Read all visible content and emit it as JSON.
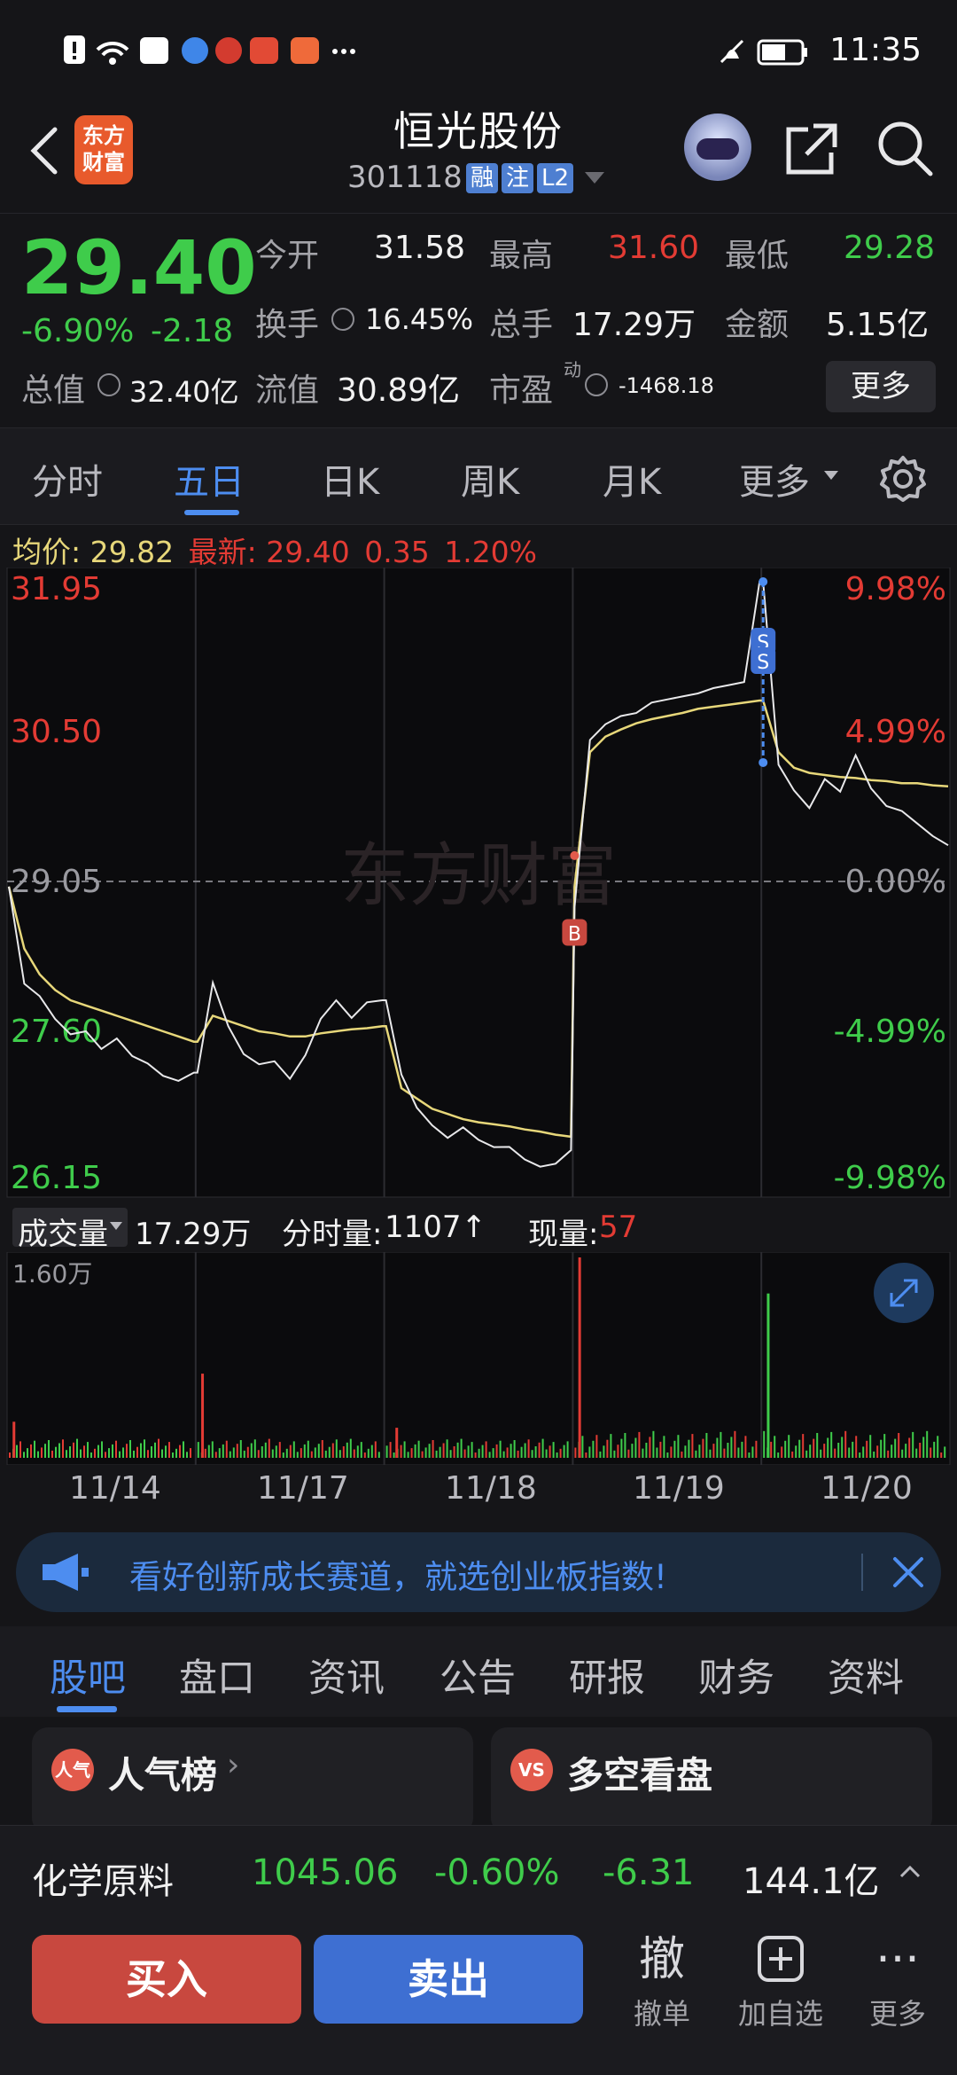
{
  "status_bar": {
    "time": "11:35"
  },
  "header": {
    "logo_text": "东方财富",
    "stock_name": "恒光股份",
    "stock_code": "301118",
    "tags": [
      "融",
      "注",
      "L2"
    ]
  },
  "quote": {
    "price": "29.40",
    "change_pct": "-6.90%",
    "change_abs": "-2.18",
    "fields": {
      "open_label": "今开",
      "open": "31.58",
      "high_label": "最高",
      "high": "31.60",
      "low_label": "最低",
      "low": "29.28",
      "turnover_label": "换手",
      "turnover": "16.45%",
      "volume_label": "总手",
      "volume": "17.29万",
      "amount_label": "金额",
      "amount": "5.15亿",
      "mktcap_label": "总值",
      "mktcap": "32.40亿",
      "float_label": "流值",
      "float": "30.89亿",
      "pe_label": "市盈",
      "pe_sup": "动",
      "pe": "-1468.18"
    },
    "more_label": "更多"
  },
  "tabs": [
    "分时",
    "五日",
    "日K",
    "周K",
    "月K",
    "更多"
  ],
  "legend": {
    "avg_label": "均价:",
    "avg": "29.82",
    "latest_label": "最新:",
    "latest": "29.40",
    "change": "0.35",
    "pct": "1.20%"
  },
  "chart_data": {
    "type": "line",
    "title": "",
    "y_left_ticks": [
      "31.95",
      "30.50",
      "29.05",
      "27.60",
      "26.15"
    ],
    "y_right_ticks": [
      "9.98%",
      "4.99%",
      "0.00%",
      "-4.99%",
      "-9.98%"
    ],
    "ylim": [
      26.15,
      31.95
    ],
    "x_categories": [
      "11/14",
      "11/17",
      "11/18",
      "11/19",
      "11/20"
    ],
    "watermark": "东方财富",
    "markers": [
      {
        "label": "B",
        "day": "11/18"
      },
      {
        "label": "S",
        "day": "11/19"
      },
      {
        "label": "S",
        "day": "11/19"
      }
    ],
    "price_series": [
      [
        29.0,
        28.05,
        27.95,
        27.75,
        27.55,
        27.6,
        27.45,
        27.5,
        27.35,
        27.3,
        27.2,
        27.1,
        27.2
      ],
      [
        27.2,
        28.05,
        27.65,
        27.4,
        27.25,
        27.3,
        27.15,
        27.4,
        27.7,
        27.9,
        27.75,
        27.85,
        27.9
      ],
      [
        27.9,
        27.15,
        26.85,
        26.7,
        26.6,
        26.65,
        26.55,
        26.5,
        26.45,
        26.35,
        26.3,
        26.35,
        26.45
      ],
      [
        28.8,
        30.45,
        30.55,
        30.65,
        30.7,
        30.75,
        30.8,
        30.85,
        30.9,
        30.9,
        30.95,
        31.0,
        31.95
      ],
      [
        31.95,
        30.2,
        29.9,
        29.75,
        30.05,
        29.95,
        30.25,
        29.95,
        29.8,
        29.7,
        29.6,
        29.5,
        29.4
      ]
    ],
    "avg_series": [
      [
        29.0,
        28.4,
        28.15,
        28.0,
        27.9,
        27.85,
        27.8,
        27.75,
        27.7,
        27.65,
        27.6,
        27.55,
        27.5
      ],
      [
        27.5,
        27.75,
        27.7,
        27.65,
        27.6,
        27.58,
        27.55,
        27.55,
        27.58,
        27.6,
        27.62,
        27.63,
        27.65
      ],
      [
        27.65,
        27.05,
        26.95,
        26.85,
        26.8,
        26.75,
        26.72,
        26.7,
        26.68,
        26.65,
        26.63,
        26.6,
        26.58
      ],
      [
        29.0,
        30.3,
        30.45,
        30.52,
        30.58,
        30.62,
        30.65,
        30.68,
        30.72,
        30.74,
        30.76,
        30.78,
        30.8
      ],
      [
        30.8,
        30.3,
        30.15,
        30.1,
        30.08,
        30.06,
        30.05,
        30.03,
        30.02,
        30.0,
        30.0,
        29.98,
        29.97
      ]
    ]
  },
  "volume": {
    "label": "成交量",
    "total": "17.29万",
    "minute_label": "分时量:",
    "minute_value": "1107↑",
    "current_label": "现量:",
    "current_value": "57",
    "axis_max": "1.60万",
    "bars": {
      "spikes": [
        {
          "day": 0,
          "pos": 0.02,
          "value": 0.18
        },
        {
          "day": 1,
          "pos": 0.02,
          "value": 0.42
        },
        {
          "day": 2,
          "pos": 0.05,
          "value": 0.15
        },
        {
          "day": 3,
          "pos": 0.02,
          "value": 1.0
        },
        {
          "day": 4,
          "pos": 0.02,
          "value": 0.82
        }
      ]
    }
  },
  "banner": {
    "text": "看好创新成长赛道，就选创业板指数!"
  },
  "subtabs": [
    "股吧",
    "盘口",
    "资讯",
    "公告",
    "研报",
    "财务",
    "资料"
  ],
  "cards": [
    {
      "icon": "人气",
      "title": "人气榜"
    },
    {
      "icon": "VS",
      "title": "多空看盘"
    }
  ],
  "index_bar": {
    "name": "化学原料",
    "value": "1045.06",
    "pct": "-0.60%",
    "change": "-6.31",
    "amount": "144.1亿"
  },
  "trade": {
    "buy": "买入",
    "sell": "卖出",
    "actions": [
      {
        "glyph": "撤",
        "label": "撤单"
      },
      {
        "glyph": "+",
        "label": "加自选"
      },
      {
        "glyph": "···",
        "label": "更多"
      }
    ]
  },
  "colors": {
    "up": "#e33b34",
    "down": "#3fcc4b",
    "accent": "#4d8df0",
    "avg_line": "#e7d77a"
  }
}
